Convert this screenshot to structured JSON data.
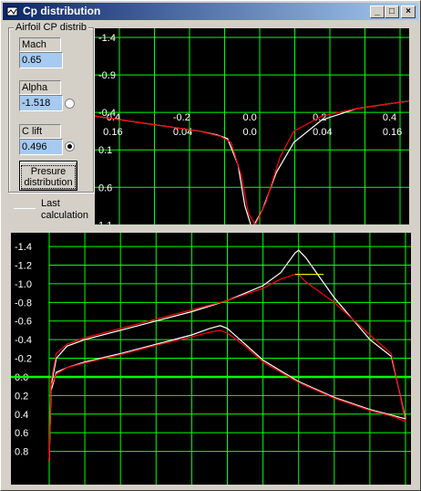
{
  "window": {
    "title": "Cp distribution",
    "icon": "app-icon",
    "controls": {
      "minimize": "_",
      "maximize": "□",
      "close": "×"
    }
  },
  "panel": {
    "group_title": "Airfoil CP distrib",
    "mach": {
      "label": "Mach",
      "value": "0.65"
    },
    "alpha": {
      "label": "Alpha",
      "value": "-1.518",
      "radio_selected": false
    },
    "clift": {
      "label": "C lift",
      "value": "0.496",
      "radio_selected": true
    },
    "button_line1": "Presure",
    "button_line2": "distribution",
    "legend": {
      "line1": "Last",
      "line2": "calculation",
      "color": "#ffffff"
    }
  },
  "colors": {
    "plot_bg": "#000000",
    "grid": "#00ff00",
    "last_calc": "#ffffff",
    "current": "#ff0000",
    "zero_line": "#00ff00"
  },
  "chart_data": [
    {
      "type": "line",
      "title": "",
      "y_tick_labels": [
        "-1.4",
        "-0.9",
        "-0.4",
        "0.1",
        "0.6",
        "1.1"
      ],
      "y_ticks": [
        -1.4,
        -0.9,
        -0.4,
        0.1,
        0.6,
        1.1
      ],
      "ylim": [
        -1.4,
        1.4
      ],
      "x_tick_labels_top": [
        "-0.4",
        "-0.2",
        "0.0",
        "0.2",
        "0.4"
      ],
      "x_ticks_top": [
        -0.4,
        -0.2,
        0.0,
        0.2,
        0.4
      ],
      "x_tick_labels_bottom": [
        "0.16",
        "0.04",
        "0.0",
        "0.04",
        "0.16"
      ],
      "x_ticks_bottom": [
        -0.4,
        -0.2,
        0.0,
        0.2,
        0.4
      ],
      "xlim": [
        -0.45,
        0.45
      ],
      "grid": true,
      "series": [
        {
          "color": "#ffffff",
          "x": [
            -0.45,
            -0.3,
            -0.15,
            -0.1,
            -0.07,
            -0.04,
            -0.02,
            0.0,
            0.03,
            0.07,
            0.12,
            0.2,
            0.3,
            0.4,
            0.45
          ],
          "y": [
            -0.35,
            -0.25,
            -0.15,
            -0.1,
            -0.05,
            0.3,
            0.85,
            1.15,
            0.9,
            0.4,
            0.0,
            -0.3,
            -0.45,
            -0.52,
            -0.55
          ]
        },
        {
          "color": "#ff0000",
          "x": [
            -0.45,
            -0.3,
            -0.15,
            -0.09,
            -0.06,
            -0.03,
            -0.01,
            0.01,
            0.04,
            0.08,
            0.12,
            0.2,
            0.3,
            0.4,
            0.45
          ],
          "y": [
            -0.35,
            -0.25,
            -0.15,
            -0.08,
            0.0,
            0.45,
            0.95,
            1.1,
            0.8,
            0.2,
            -0.15,
            -0.35,
            -0.45,
            -0.52,
            -0.55
          ]
        }
      ]
    },
    {
      "type": "line",
      "title": "",
      "y_tick_labels": [
        "-1.4",
        "-1.2",
        "-1.0",
        "-0.8",
        "-0.6",
        "-0.4",
        "-0.2",
        "0.0",
        "0.2",
        "0.4",
        "0.6",
        "0.8"
      ],
      "y_ticks": [
        -1.4,
        -1.2,
        -1.0,
        -0.8,
        -0.6,
        -0.4,
        -0.2,
        0.0,
        0.2,
        0.4,
        0.6,
        0.8
      ],
      "ylim": [
        -1.45,
        1.0
      ],
      "xlim": [
        0,
        1
      ],
      "grid": true,
      "series": [
        {
          "color": "#ffffff",
          "x": [
            0.0,
            0.005,
            0.02,
            0.05,
            0.1,
            0.2,
            0.3,
            0.4,
            0.5,
            0.6,
            0.65,
            0.69,
            0.7,
            0.72,
            0.8,
            0.9,
            0.96,
            1.0
          ],
          "y": [
            0.9,
            0.1,
            -0.2,
            -0.33,
            -0.4,
            -0.5,
            -0.6,
            -0.7,
            -0.82,
            -0.98,
            -1.12,
            -1.33,
            -1.36,
            -1.28,
            -0.85,
            -0.4,
            -0.22,
            0.45
          ]
        },
        {
          "color": "#ff0000",
          "x": [
            0.0,
            0.005,
            0.02,
            0.05,
            0.1,
            0.2,
            0.3,
            0.4,
            0.5,
            0.6,
            0.65,
            0.69,
            0.7,
            0.72,
            0.8,
            0.9,
            0.96,
            1.0
          ],
          "y": [
            0.9,
            0.05,
            -0.25,
            -0.35,
            -0.42,
            -0.52,
            -0.62,
            -0.72,
            -0.82,
            -0.95,
            -1.05,
            -1.1,
            -1.1,
            -1.02,
            -0.8,
            -0.45,
            -0.25,
            0.48
          ]
        },
        {
          "color": "#ffffff",
          "x": [
            0.0,
            0.005,
            0.02,
            0.05,
            0.1,
            0.2,
            0.3,
            0.4,
            0.45,
            0.48,
            0.5,
            0.55,
            0.6,
            0.7,
            0.8,
            0.9,
            0.97,
            1.0
          ],
          "y": [
            0.9,
            0.15,
            -0.05,
            -0.1,
            -0.16,
            -0.25,
            -0.35,
            -0.45,
            -0.52,
            -0.55,
            -0.52,
            -0.35,
            -0.18,
            0.05,
            0.22,
            0.35,
            0.42,
            0.45
          ]
        },
        {
          "color": "#ff0000",
          "x": [
            0.0,
            0.005,
            0.02,
            0.05,
            0.1,
            0.2,
            0.3,
            0.4,
            0.45,
            0.48,
            0.5,
            0.55,
            0.6,
            0.7,
            0.8,
            0.9,
            0.97,
            1.0
          ],
          "y": [
            0.9,
            0.1,
            -0.03,
            -0.1,
            -0.15,
            -0.24,
            -0.34,
            -0.43,
            -0.48,
            -0.5,
            -0.47,
            -0.33,
            -0.16,
            0.06,
            0.23,
            0.36,
            0.43,
            0.48
          ]
        },
        {
          "color": "#ffff00",
          "x": [
            0.69,
            0.77
          ],
          "y": [
            -1.1,
            -1.1
          ]
        }
      ],
      "zero_line": {
        "y": 0.0,
        "color": "#00ff00"
      }
    }
  ]
}
